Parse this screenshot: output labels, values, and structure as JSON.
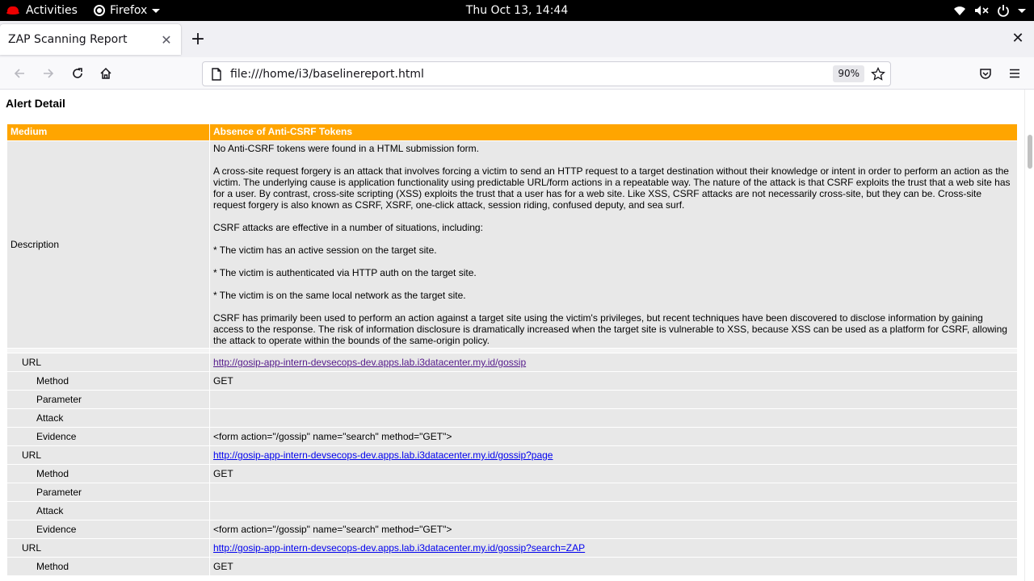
{
  "system_bar": {
    "activities": "Activities",
    "app_name": "Firefox",
    "clock": "Thu Oct 13, 14:44"
  },
  "browser": {
    "tab_title": "ZAP Scanning Report",
    "url": "file:///home/i3/baselinereport.html",
    "zoom": "90%"
  },
  "report": {
    "section_title": "Alert Detail",
    "risk": "Medium",
    "alert_name": "Absence of Anti-CSRF Tokens",
    "description_label": "Description",
    "description_paragraphs": [
      "No Anti-CSRF tokens were found in a HTML submission form.",
      "A cross-site request forgery is an attack that involves forcing a victim to send an HTTP request to a target destination without their knowledge or intent in order to perform an action as the victim. The underlying cause is application functionality using predictable URL/form actions in a repeatable way. The nature of the attack is that CSRF exploits the trust that a web site has for a user. By contrast, cross-site scripting (XSS) exploits the trust that a user has for a web site. Like XSS, CSRF attacks are not necessarily cross-site, but they can be. Cross-site request forgery is also known as CSRF, XSRF, one-click attack, session riding, confused deputy, and sea surf.",
      "CSRF attacks are effective in a number of situations, including:",
      "* The victim has an active session on the target site.",
      "* The victim is authenticated via HTTP auth on the target site.",
      "* The victim is on the same local network as the target site.",
      "CSRF has primarily been used to perform an action against a target site using the victim's privileges, but recent techniques have been discovered to disclose information by gaining access to the response. The risk of information disclosure is dramatically increased when the target site is vulnerable to XSS, because XSS can be used as a platform for CSRF, allowing the attack to operate within the bounds of the same-origin policy."
    ],
    "labels": {
      "url": "URL",
      "method": "Method",
      "parameter": "Parameter",
      "attack": "Attack",
      "evidence": "Evidence"
    },
    "instances": [
      {
        "url": "http://gosip-app-intern-devsecops-dev.apps.lab.i3datacenter.my.id/gossip",
        "method": "GET",
        "parameter": "",
        "attack": "",
        "evidence": "<form action=\"/gossip\" name=\"search\" method=\"GET\">"
      },
      {
        "url": "http://gosip-app-intern-devsecops-dev.apps.lab.i3datacenter.my.id/gossip?page",
        "method": "GET",
        "parameter": "",
        "attack": "",
        "evidence": "<form action=\"/gossip\" name=\"search\" method=\"GET\">"
      },
      {
        "url": "http://gosip-app-intern-devsecops-dev.apps.lab.i3datacenter.my.id/gossip?search=ZAP",
        "method": "GET"
      }
    ]
  },
  "colors": {
    "risk_medium": "#ffa500",
    "cell_bg": "#e8e8e8",
    "link": "#0000ee",
    "link_visited": "#551a8b"
  }
}
